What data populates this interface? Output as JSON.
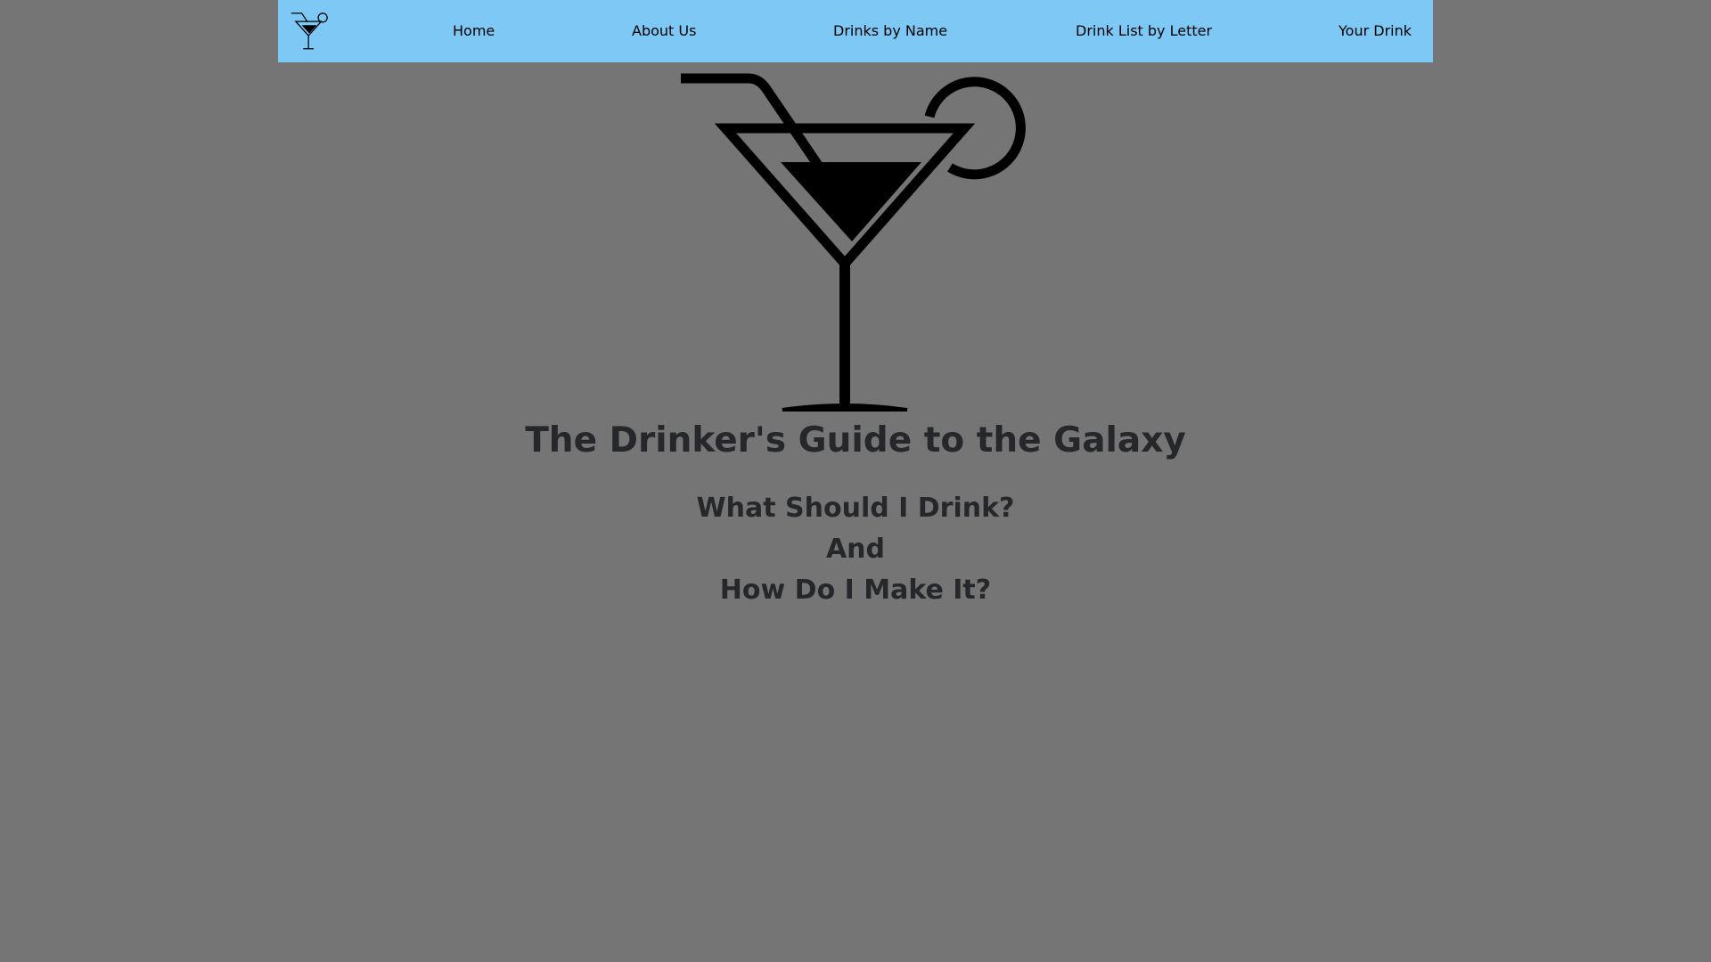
{
  "nav": {
    "logo_icon": "martini-glass-icon",
    "background_color": "#7ec8f6",
    "links": [
      {
        "label": "Home"
      },
      {
        "label": "About Us"
      },
      {
        "label": "Drinks by Name"
      },
      {
        "label": "Drink List by Letter"
      },
      {
        "label": "Your Drink"
      }
    ]
  },
  "hero": {
    "icon": "cocktail-glass-icon",
    "title": "The Drinker's Guide to the Galaxy",
    "tagline": [
      "What Should I Drink?",
      "And",
      "How Do I Make It?"
    ]
  },
  "colors": {
    "page_background": "#757575",
    "text": "#26272a"
  }
}
